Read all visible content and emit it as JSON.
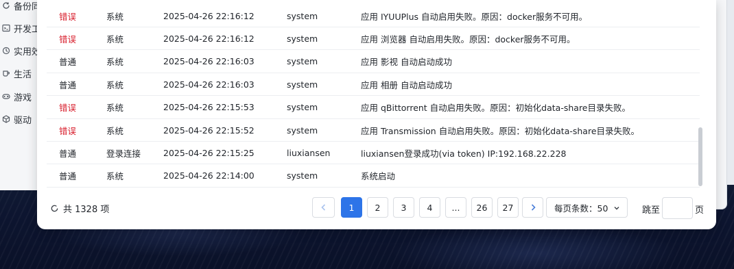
{
  "sidebar": {
    "items": [
      {
        "label": "备份同步",
        "icon": "sync-icon"
      },
      {
        "label": "开发工具",
        "icon": "code-icon"
      },
      {
        "label": "实用效率",
        "icon": "tool-icon"
      },
      {
        "label": "生活",
        "icon": "cup-icon"
      },
      {
        "label": "游戏",
        "icon": "gamepad-icon"
      },
      {
        "label": "驱动",
        "icon": "cube-icon"
      }
    ]
  },
  "colors": {
    "error": "#d81e2c",
    "accent": "#2d74e8"
  },
  "logs": {
    "rows": [
      {
        "level": "错误",
        "level_type": "error",
        "type": "系统",
        "time": "2025-04-26 22:16:12",
        "user": "system",
        "message": "应用 IYUUPlus 自动启用失败。原因：docker服务不可用。"
      },
      {
        "level": "错误",
        "level_type": "error",
        "type": "系统",
        "time": "2025-04-26 22:16:12",
        "user": "system",
        "message": "应用 浏览器 自动启用失败。原因：docker服务不可用。"
      },
      {
        "level": "普通",
        "level_type": "normal",
        "type": "系统",
        "time": "2025-04-26 22:16:03",
        "user": "system",
        "message": "应用 影视 自动启动成功"
      },
      {
        "level": "普通",
        "level_type": "normal",
        "type": "系统",
        "time": "2025-04-26 22:16:03",
        "user": "system",
        "message": "应用 相册 自动启动成功"
      },
      {
        "level": "错误",
        "level_type": "error",
        "type": "系统",
        "time": "2025-04-26 22:15:53",
        "user": "system",
        "message": "应用 qBittorrent 自动启用失败。原因：初始化data-share目录失败。"
      },
      {
        "level": "错误",
        "level_type": "error",
        "type": "系统",
        "time": "2025-04-26 22:15:52",
        "user": "system",
        "message": "应用 Transmission 自动启用失败。原因：初始化data-share目录失败。"
      },
      {
        "level": "普通",
        "level_type": "normal",
        "type": "登录连接",
        "time": "2025-04-26 22:15:25",
        "user": "liuxiansen",
        "message": "liuxiansen登录成功(via token) IP:192.168.22.228"
      },
      {
        "level": "普通",
        "level_type": "normal",
        "type": "系统",
        "time": "2025-04-26 22:14:00",
        "user": "system",
        "message": "系统启动"
      }
    ]
  },
  "pagination": {
    "total_text": "共 1328 项",
    "pages": [
      "1",
      "2",
      "3",
      "4",
      "...",
      "26",
      "27"
    ],
    "current_page": "1",
    "page_size_label": "每页条数：50",
    "jump_label": "跳至",
    "jump_value": "",
    "jump_unit": "页"
  }
}
